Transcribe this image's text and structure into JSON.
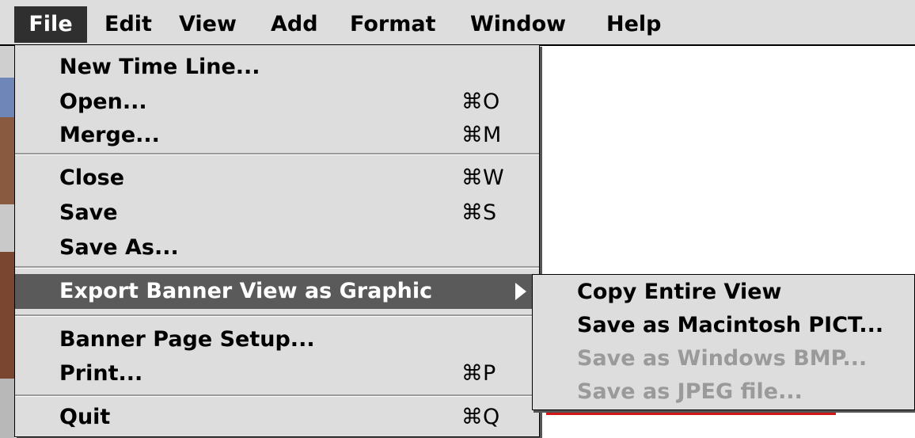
{
  "menubar": {
    "items": [
      "File",
      "Edit",
      "View",
      "Add",
      "Format",
      "Window",
      "Help"
    ],
    "active": "File"
  },
  "file_menu": {
    "groups": [
      [
        {
          "label": "New Time Line...",
          "shortcut": ""
        },
        {
          "label": "Open...",
          "shortcut": "⌘O"
        },
        {
          "label": "Merge...",
          "shortcut": "⌘M"
        }
      ],
      [
        {
          "label": "Close",
          "shortcut": "⌘W"
        },
        {
          "label": "Save",
          "shortcut": "⌘S"
        },
        {
          "label": "Save As...",
          "shortcut": ""
        }
      ],
      [
        {
          "label": "Export Banner View as Graphic",
          "shortcut": "",
          "submenu": true,
          "highlighted": true
        }
      ],
      [
        {
          "label": "Banner Page Setup...",
          "shortcut": ""
        },
        {
          "label": "Print...",
          "shortcut": "⌘P"
        }
      ],
      [
        {
          "label": "Quit",
          "shortcut": "⌘Q"
        }
      ]
    ]
  },
  "export_submenu": {
    "items": [
      {
        "label": "Copy Entire View",
        "enabled": true
      },
      {
        "label": "Save as Macintosh PICT...",
        "enabled": true
      },
      {
        "label": "Save as Windows BMP...",
        "enabled": false
      },
      {
        "label": "Save as JPEG file...",
        "enabled": false
      }
    ]
  },
  "colors": {
    "menu_bg": "#dddddd",
    "highlight": "#5a5a5a",
    "disabled_text": "#9a9a9a"
  }
}
